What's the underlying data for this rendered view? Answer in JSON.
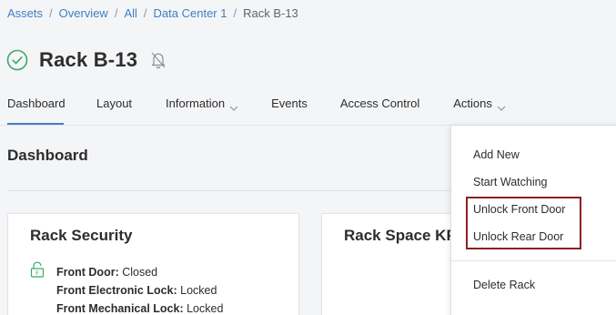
{
  "breadcrumb": {
    "items": [
      "Assets",
      "Overview",
      "All",
      "Data Center 1"
    ],
    "current": "Rack B-13",
    "separator": "/"
  },
  "header": {
    "title": "Rack B-13",
    "status_icon": "check-circle-icon",
    "status_color": "#3aa86b",
    "watch_icon": "bell-off-icon"
  },
  "tabs": [
    {
      "label": "Dashboard",
      "active": true
    },
    {
      "label": "Layout"
    },
    {
      "label": "Information",
      "has_dropdown": true
    },
    {
      "label": "Events"
    },
    {
      "label": "Access Control"
    },
    {
      "label": "Actions",
      "has_dropdown": true,
      "open": true
    }
  ],
  "section": {
    "title": "Dashboard"
  },
  "cards": {
    "security": {
      "title": "Rack Security",
      "icon": "lock-open-icon",
      "icon_color": "#3aa86b",
      "rows": [
        {
          "label": "Front Door:",
          "value": " Closed"
        },
        {
          "label": "Front Electronic Lock:",
          "value": " Locked"
        },
        {
          "label": "Front Mechanical Lock:",
          "value": " Locked"
        }
      ]
    },
    "kpi": {
      "title": "Rack Space KPI"
    }
  },
  "actions_menu": {
    "items": [
      "Add New",
      "Start Watching",
      "Unlock Front Door",
      "Unlock Rear Door"
    ],
    "danger_item": "Delete Rack",
    "highlight_color": "#8b2023"
  },
  "colors": {
    "accent": "#3d7fc4"
  }
}
